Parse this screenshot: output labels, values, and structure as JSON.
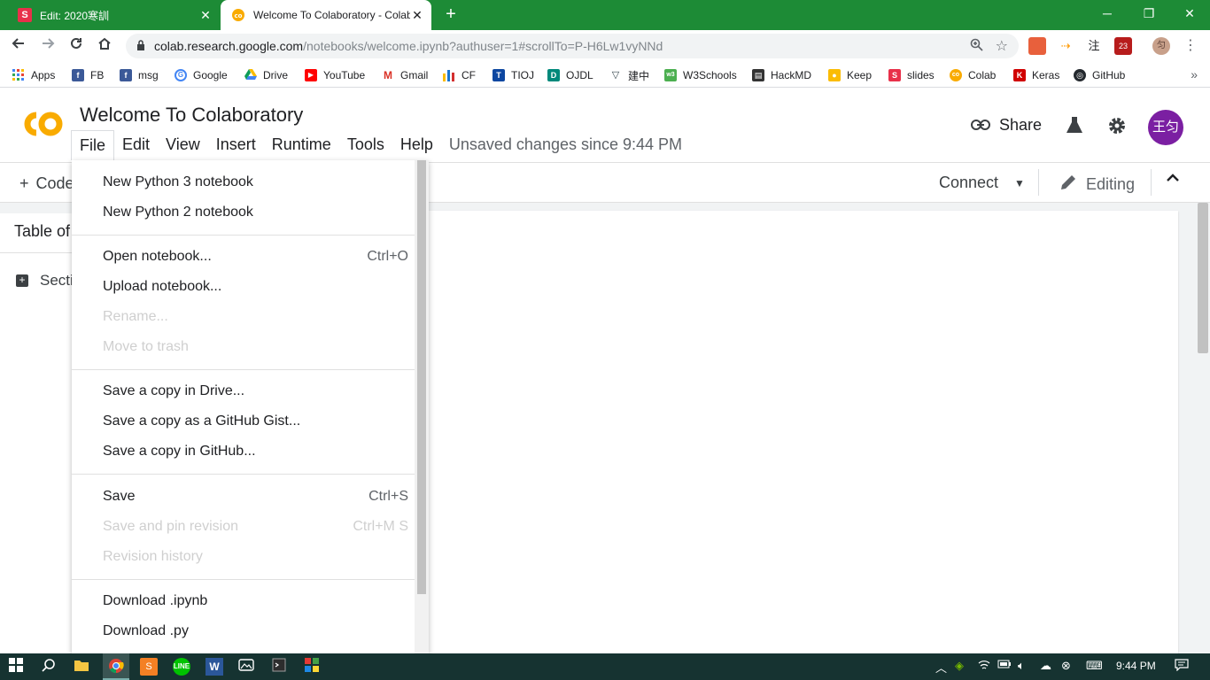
{
  "browser": {
    "tabs": [
      {
        "favicon_letter": "S",
        "favicon_color": "#e8304a",
        "title": "Edit: 2020寒訓",
        "close": "✕"
      },
      {
        "favicon_letter": "co",
        "favicon_color": "#f9ab00",
        "title": "Welcome To Colaboratory - Colab",
        "close": "✕"
      }
    ],
    "new_tab": "+",
    "window_controls": {
      "minimize": "─",
      "restore": "❐",
      "close": "✕"
    },
    "url_host": "colab.research.google.com",
    "url_path": "/notebooks/welcome.ipynb?authuser=1#scrollTo=P-H6Lw1vyNNd",
    "bookmarks": [
      {
        "label": "Apps",
        "icon": "apps-grid-icon",
        "color": "#4285f4"
      },
      {
        "label": "FB",
        "icon": "facebook-icon",
        "color": "#3b5998"
      },
      {
        "label": "msg",
        "icon": "facebook-icon",
        "color": "#3b5998"
      },
      {
        "label": "Google",
        "icon": "google-icon",
        "color": "#4285f4"
      },
      {
        "label": "Drive",
        "icon": "drive-icon",
        "color": "#0f9d58"
      },
      {
        "label": "YouTube",
        "icon": "youtube-icon",
        "color": "#ff0000"
      },
      {
        "label": "Gmail",
        "icon": "gmail-icon",
        "color": "#d93025"
      },
      {
        "label": "CF",
        "icon": "codeforces-icon",
        "color": "#1976d2"
      },
      {
        "label": "TIOJ",
        "icon": "tioj-icon",
        "color": "#0d47a1"
      },
      {
        "label": "OJDL",
        "icon": "ojdl-icon",
        "color": "#00897b"
      },
      {
        "label": "建中",
        "icon": "school-icon",
        "color": "#37474f"
      },
      {
        "label": "W3Schools",
        "icon": "w3schools-icon",
        "color": "#4caf50"
      },
      {
        "label": "HackMD",
        "icon": "hackmd-icon",
        "color": "#333333"
      },
      {
        "label": "Keep",
        "icon": "keep-icon",
        "color": "#fbbc04"
      },
      {
        "label": "slides",
        "icon": "slides-icon",
        "color": "#e8304a"
      },
      {
        "label": "Colab",
        "icon": "colab-icon",
        "color": "#f9ab00"
      },
      {
        "label": "Keras",
        "icon": "keras-icon",
        "color": "#d00000"
      },
      {
        "label": "GitHub",
        "icon": "github-icon",
        "color": "#24292e"
      }
    ],
    "bookmarks_overflow": "»"
  },
  "colab": {
    "notebook_title": "Welcome To Colaboratory",
    "menus": [
      "File",
      "Edit",
      "View",
      "Insert",
      "Runtime",
      "Tools",
      "Help"
    ],
    "unsaved_text": "Unsaved changes since 9:44 PM",
    "share_label": "Share",
    "avatar_text": "王匀",
    "add_code_label": "Code",
    "connect_label": "Connect",
    "editing_label": "Editing",
    "toc_title": "Table of contents",
    "toc_item": "Section"
  },
  "file_menu": {
    "items": [
      {
        "label": "New Python 3 notebook",
        "shortcut": "",
        "enabled": true
      },
      {
        "label": "New Python 2 notebook",
        "shortcut": "",
        "enabled": true
      },
      {
        "label": "Open notebook...",
        "shortcut": "Ctrl+O",
        "enabled": true
      },
      {
        "label": "Upload notebook...",
        "shortcut": "",
        "enabled": true
      },
      {
        "label": "Rename...",
        "shortcut": "",
        "enabled": false
      },
      {
        "label": "Move to trash",
        "shortcut": "",
        "enabled": false
      },
      {
        "label": "Save a copy in Drive...",
        "shortcut": "",
        "enabled": true
      },
      {
        "label": "Save a copy as a GitHub Gist...",
        "shortcut": "",
        "enabled": true
      },
      {
        "label": "Save a copy in GitHub...",
        "shortcut": "",
        "enabled": true
      },
      {
        "label": "Save",
        "shortcut": "Ctrl+S",
        "enabled": true
      },
      {
        "label": "Save and pin revision",
        "shortcut": "Ctrl+M S",
        "enabled": false
      },
      {
        "label": "Revision history",
        "shortcut": "",
        "enabled": false
      },
      {
        "label": "Download .ipynb",
        "shortcut": "",
        "enabled": true
      },
      {
        "label": "Download .py",
        "shortcut": "",
        "enabled": true
      }
    ]
  },
  "taskbar": {
    "clock": "9:44 PM"
  },
  "colors": {
    "tab_strip": "#1d8b36",
    "taskbar": "#163331",
    "avatar": "#7b1fa2",
    "colab_orange": "#f9ab00"
  }
}
